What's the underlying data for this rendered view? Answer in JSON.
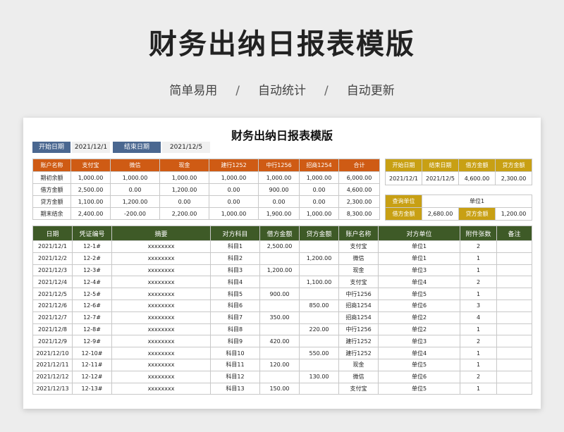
{
  "hero": {
    "title": "财务出纳日报表模版",
    "features": [
      "简单易用",
      "自动统计",
      "自动更新"
    ],
    "separator": "/"
  },
  "sheet_title": "财务出纳日报表模版",
  "date_bar": {
    "start_label": "开始日期",
    "start_value": "2021/12/1",
    "end_label": "结束日期",
    "end_value": "2021/12/5"
  },
  "summary": {
    "headers": [
      "账户名称",
      "支付宝",
      "微信",
      "现金",
      "建行1252",
      "中行1256",
      "招商1254",
      "合计"
    ],
    "rows": [
      [
        "期初余额",
        "1,000.00",
        "1,000.00",
        "1,000.00",
        "1,000.00",
        "1,000.00",
        "1,000.00",
        "6,000.00"
      ],
      [
        "借方金额",
        "2,500.00",
        "0.00",
        "1,200.00",
        "0.00",
        "900.00",
        "0.00",
        "4,600.00"
      ],
      [
        "贷方金额",
        "1,100.00",
        "1,200.00",
        "0.00",
        "0.00",
        "0.00",
        "0.00",
        "2,300.00"
      ],
      [
        "期末结余",
        "2,400.00",
        "-200.00",
        "2,200.00",
        "1,000.00",
        "1,900.00",
        "1,000.00",
        "8,300.00"
      ]
    ]
  },
  "right_summary": {
    "headers": [
      "开始日期",
      "结束日期",
      "借方金额",
      "贷方金额"
    ],
    "values": [
      "2021/12/1",
      "2021/12/5",
      "4,600.00",
      "2,300.00"
    ]
  },
  "query": {
    "label": "查询单位",
    "value": "单位1",
    "debit_label": "借方金额",
    "debit_value": "2,680.00",
    "credit_label": "贷方金额",
    "credit_value": "1,200.00"
  },
  "detail": {
    "headers": [
      "日期",
      "凭证编号",
      "摘要",
      "对方科目",
      "借方金额",
      "贷方金额",
      "账户名称",
      "对方单位",
      "附件张数",
      "备注"
    ],
    "rows": [
      {
        "date": "2021/12/1",
        "voucher": "12-1#",
        "summary": "xxxxxxxx",
        "subject": "科目1",
        "debit": "2,500.00",
        "credit": "",
        "account": "支付宝",
        "unit": "单位1",
        "attach": "2",
        "note": ""
      },
      {
        "date": "2021/12/2",
        "voucher": "12-2#",
        "summary": "xxxxxxxx",
        "subject": "科目2",
        "debit": "",
        "credit": "1,200.00",
        "account": "微信",
        "unit": "单位1",
        "attach": "1",
        "note": ""
      },
      {
        "date": "2021/12/3",
        "voucher": "12-3#",
        "summary": "xxxxxxxx",
        "subject": "科目3",
        "debit": "1,200.00",
        "credit": "",
        "account": "现金",
        "unit": "单位3",
        "attach": "1",
        "note": ""
      },
      {
        "date": "2021/12/4",
        "voucher": "12-4#",
        "summary": "xxxxxxxx",
        "subject": "科目4",
        "debit": "",
        "credit": "1,100.00",
        "account": "支付宝",
        "unit": "单位4",
        "attach": "2",
        "note": ""
      },
      {
        "date": "2021/12/5",
        "voucher": "12-5#",
        "summary": "xxxxxxxx",
        "subject": "科目5",
        "debit": "900.00",
        "credit": "",
        "account": "中行1256",
        "unit": "单位5",
        "attach": "1",
        "note": ""
      },
      {
        "date": "2021/12/6",
        "voucher": "12-6#",
        "summary": "xxxxxxxx",
        "subject": "科目6",
        "debit": "",
        "credit": "850.00",
        "account": "招商1254",
        "unit": "单位6",
        "attach": "3",
        "note": ""
      },
      {
        "date": "2021/12/7",
        "voucher": "12-7#",
        "summary": "xxxxxxxx",
        "subject": "科目7",
        "debit": "350.00",
        "credit": "",
        "account": "招商1254",
        "unit": "单位2",
        "attach": "4",
        "note": ""
      },
      {
        "date": "2021/12/8",
        "voucher": "12-8#",
        "summary": "xxxxxxxx",
        "subject": "科目8",
        "debit": "",
        "credit": "220.00",
        "account": "中行1256",
        "unit": "单位2",
        "attach": "1",
        "note": ""
      },
      {
        "date": "2021/12/9",
        "voucher": "12-9#",
        "summary": "xxxxxxxx",
        "subject": "科目9",
        "debit": "420.00",
        "credit": "",
        "account": "建行1252",
        "unit": "单位3",
        "attach": "2",
        "note": ""
      },
      {
        "date": "2021/12/10",
        "voucher": "12-10#",
        "summary": "xxxxxxxx",
        "subject": "科目10",
        "debit": "",
        "credit": "550.00",
        "account": "建行1252",
        "unit": "单位4",
        "attach": "1",
        "note": ""
      },
      {
        "date": "2021/12/11",
        "voucher": "12-11#",
        "summary": "xxxxxxxx",
        "subject": "科目11",
        "debit": "120.00",
        "credit": "",
        "account": "现金",
        "unit": "单位5",
        "attach": "1",
        "note": ""
      },
      {
        "date": "2021/12/12",
        "voucher": "12-12#",
        "summary": "xxxxxxxx",
        "subject": "科目12",
        "debit": "",
        "credit": "130.00",
        "account": "微信",
        "unit": "单位6",
        "attach": "2",
        "note": ""
      },
      {
        "date": "2021/12/13",
        "voucher": "12-13#",
        "summary": "xxxxxxxx",
        "subject": "科目13",
        "debit": "150.00",
        "credit": "",
        "account": "支付宝",
        "unit": "单位5",
        "attach": "1",
        "note": ""
      }
    ]
  }
}
